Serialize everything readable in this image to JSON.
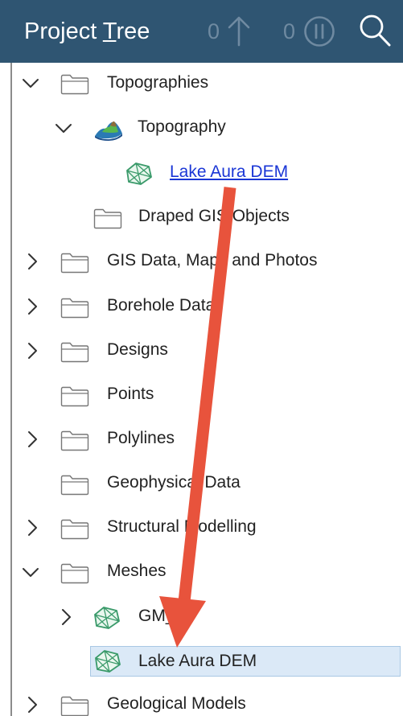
{
  "panel": {
    "title_pre": "Project ",
    "title_accel": "T",
    "title_post": "ree",
    "header_color": "#2f5572",
    "upload_count": "0",
    "pause_count": "0",
    "upload_icon": "arrow-up-icon",
    "pause_icon": "pause-circle-icon",
    "search_icon": "search-icon"
  },
  "tree": {
    "items": [
      {
        "label": "Topographies",
        "expanded": true,
        "icon": "folder-icon"
      },
      {
        "label": "Topography",
        "expanded": true,
        "icon": "topography-icon"
      },
      {
        "label": "Lake Aura DEM",
        "icon": "mesh-icon",
        "style": "link"
      },
      {
        "label": "Draped GIS Objects",
        "icon": "folder-icon"
      },
      {
        "label": "GIS Data, Maps and Photos",
        "expanded": false,
        "icon": "folder-icon"
      },
      {
        "label": "Borehole Data",
        "expanded": false,
        "icon": "folder-icon"
      },
      {
        "label": "Designs",
        "expanded": false,
        "icon": "folder-icon"
      },
      {
        "label": "Points",
        "icon": "folder-icon"
      },
      {
        "label": "Polylines",
        "expanded": false,
        "icon": "folder-icon"
      },
      {
        "label": "Geophysical Data",
        "icon": "folder-icon"
      },
      {
        "label": "Structural Modelling",
        "expanded": false,
        "icon": "folder-icon"
      },
      {
        "label": "Meshes",
        "expanded": true,
        "icon": "folder-icon"
      },
      {
        "label": "GM_EP",
        "expanded": false,
        "icon": "mesh-icon"
      },
      {
        "label": "Lake Aura DEM",
        "icon": "mesh-icon",
        "selected": true
      },
      {
        "label": "Geological Models",
        "expanded": false,
        "icon": "folder-icon"
      }
    ]
  },
  "annotation": {
    "arrow_color": "#e8533c",
    "arrow_icon": "drag-arrow"
  }
}
